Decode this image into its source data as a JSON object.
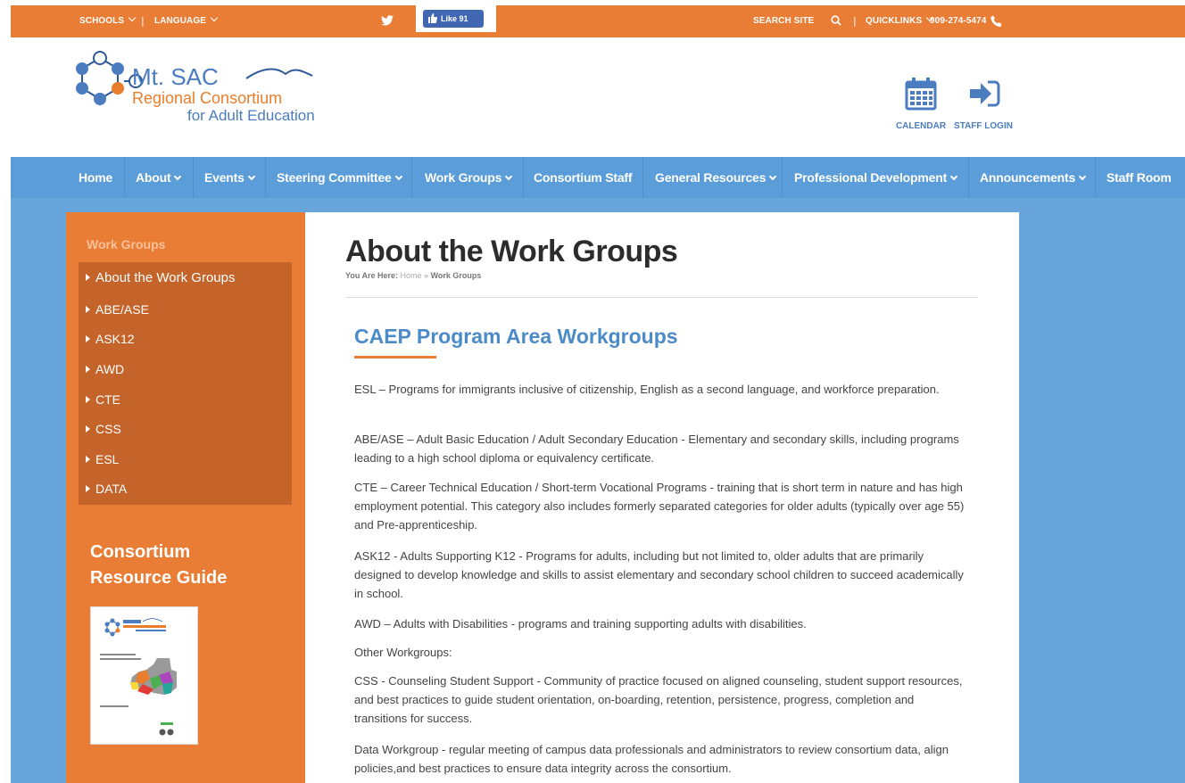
{
  "topbar": {
    "schools": "SCHOOLS",
    "language": "LANGUAGE",
    "sep": "|",
    "like": "Like 91",
    "search": "SEARCH SITE",
    "quicklinks": "QUICKLINKS",
    "phone": "909-274-5474"
  },
  "logo": {
    "line1": "Mt. SAC",
    "line2": "Regional Consortium",
    "line3": "for Adult Education"
  },
  "header": {
    "calendar": "CALENDAR",
    "staff_login": "STAFF LOGIN"
  },
  "nav": {
    "items": [
      {
        "label": "Home"
      },
      {
        "label": "About"
      },
      {
        "label": "Events"
      },
      {
        "label": "Steering Committee"
      },
      {
        "label": "Work Groups"
      },
      {
        "label": "Consortium Staff"
      },
      {
        "label": "General Resources"
      },
      {
        "label": "Professional Development"
      },
      {
        "label": "Announcements"
      },
      {
        "label": "Staff Room"
      }
    ]
  },
  "sidebar": {
    "title": "Work Groups",
    "items": [
      {
        "label": "About the Work Groups"
      },
      {
        "label": "ABE/ASE"
      },
      {
        "label": "ASK12"
      },
      {
        "label": "AWD"
      },
      {
        "label": "CTE"
      },
      {
        "label": "CSS"
      },
      {
        "label": "ESL"
      },
      {
        "label": "DATA"
      }
    ],
    "guide_title_1": "Consortium",
    "guide_title_2": "Resource Guide"
  },
  "main": {
    "title": "About the Work Groups",
    "breadcrumb": {
      "prefix": "You Are Here:",
      "home": "Home",
      "sep": "»",
      "current": "Work Groups"
    },
    "section_title": "CAEP Program Area Workgroups",
    "paragraphs": [
      "ESL – Programs for immigrants inclusive of citizenship, English as a second language, and workforce preparation.",
      "ABE/ASE – Adult Basic Education / Adult Secondary Education - Elementary and secondary skills, including programs leading to a high school diploma or equivalency certificate.",
      "CTE – Career Technical Education / Short-term Vocational Programs - training that is short term in nature and has high employment potential. This category also includes formerly separated categories for older adults (typically over age 55) and Pre-apprenticeship.",
      "ASK12 - Adults Supporting K12 - Programs for adults, including but not limited to, older adults that are primarily designed to develop knowledge and skills to assist elementary and secondary school children to succeed academically in school.",
      "AWD – Adults with Disabilities - programs and training supporting adults with disabilities.",
      "Other Workgroups:",
      "CSS - Counseling Student Support - Community of practice focused on aligned counseling, student support resources, and best practices to guide student orientation, on-boarding, retention, persistence, progress, completion and transitions for success.",
      "Data Workgroup - regular meeting of campus data professionals and administrators to review consortium data, align policies,and best practices to ensure data integrity across the consortium."
    ]
  },
  "colors": {
    "orange": "#ea7d35",
    "blue_nav": "#5a9dd8",
    "blue_bg": "#67a5da",
    "heading_blue": "#4b8bc8"
  }
}
